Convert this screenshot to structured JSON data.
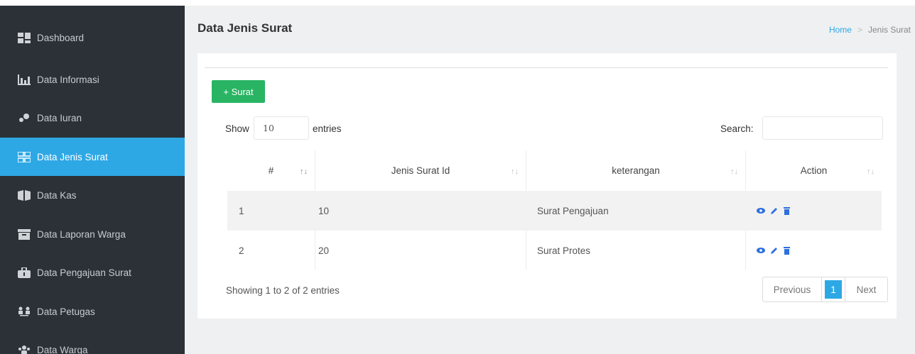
{
  "sidebar": {
    "items": [
      {
        "label": "Dashboard",
        "icon": "dashboard-icon"
      },
      {
        "label": "Data Informasi",
        "icon": "bar-chart-icon"
      },
      {
        "label": "Data Iuran",
        "icon": "coins-icon"
      },
      {
        "label": "Data Jenis Surat",
        "icon": "grid-icon",
        "active": true
      },
      {
        "label": "Data Kas",
        "icon": "book-open-icon"
      },
      {
        "label": "Data Laporan Warga",
        "icon": "archive-icon"
      },
      {
        "label": "Data Pengajuan Surat",
        "icon": "toolbox-icon"
      },
      {
        "label": "Data Petugas",
        "icon": "people-arrows-icon"
      },
      {
        "label": "Data Warga",
        "icon": "users-icon"
      }
    ]
  },
  "header": {
    "title": "Data Jenis Surat",
    "breadcrumb": {
      "home": "Home",
      "current": "Jenis Surat"
    }
  },
  "toolbar": {
    "add_label": "+ Surat",
    "show_label": "Show",
    "length_value": "10",
    "entries_label": "entries",
    "search_label": "Search:"
  },
  "table": {
    "columns": [
      "#",
      "Jenis Surat Id",
      "keterangan",
      "Action"
    ],
    "rows": [
      {
        "no": "1",
        "id": "10",
        "keterangan": "Surat Pengajuan"
      },
      {
        "no": "2",
        "id": "20",
        "keterangan": "Surat Protes"
      }
    ]
  },
  "footer": {
    "info": "Showing 1 to 2 of 2 entries",
    "prev": "Previous",
    "page": "1",
    "next": "Next"
  },
  "colors": {
    "sidebar_bg": "#2b3137",
    "accent": "#2ea8e5",
    "add_button": "#28b463",
    "action_icon": "#2e6fe0"
  }
}
